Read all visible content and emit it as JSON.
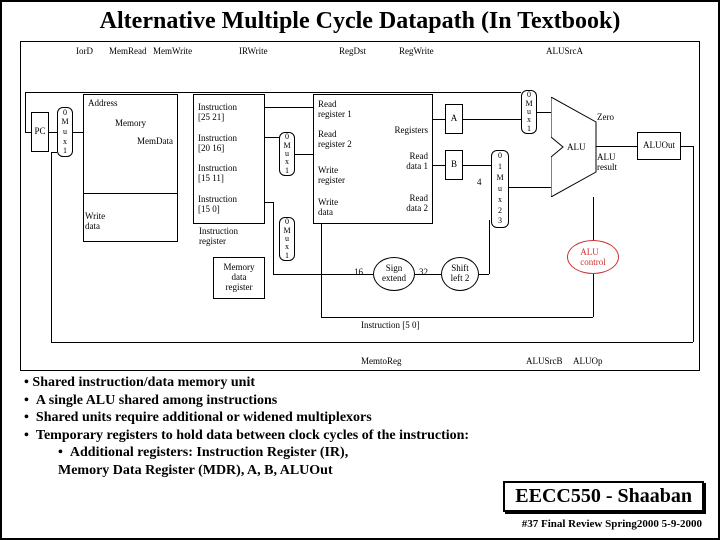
{
  "title": "Alternative Multiple Cycle Datapath (In Textbook)",
  "signals_top": {
    "iord": "IorD",
    "memread": "MemRead",
    "memwrite": "MemWrite",
    "irwrite": "IRWrite",
    "regdst": "RegDst",
    "regwrite": "RegWrite",
    "alusrca": "ALUSrcA"
  },
  "signals_bottom": {
    "memtoreg": "MemtoReg",
    "alusrcb": "ALUSrcB",
    "aluop": "ALUOp"
  },
  "blocks": {
    "pc": "PC",
    "mux01a": [
      "0",
      "M",
      "u",
      "x",
      "1"
    ],
    "address": "Address",
    "memory": "Memory",
    "memdata": "MemData",
    "writedata": "Write\ndata",
    "ir_lines": [
      "Instruction",
      "[25  21]",
      "Instruction",
      "[20  16]",
      "Instruction",
      "[15  11]",
      "Instruction",
      "[15   0]"
    ],
    "ir_caption": "Instruction\nregister",
    "mdr": "Memory\ndata\nregister",
    "mux01b": [
      "0",
      "M",
      "u",
      "x",
      "1"
    ],
    "mux01c": [
      "0",
      "M",
      "u",
      "x",
      "1"
    ],
    "regfile": {
      "rr1": "Read\nregister 1",
      "rr2": "Read\nregister 2",
      "regs": "Registers",
      "wr": "Write\nregister",
      "wd": "Write\ndata",
      "rd1": "Read\ndata 1",
      "rd2": "Read\ndata 2"
    },
    "a": "A",
    "b": "B",
    "four": "4",
    "mux4": [
      "0",
      "1",
      "M",
      "u",
      "x",
      "2",
      "3"
    ],
    "mux01d": [
      "0",
      "M",
      "u",
      "x",
      "1"
    ],
    "signext": "Sign\nextend",
    "se16": "16",
    "se32": "32",
    "shl2": "Shift\nleft 2",
    "zero": "Zero",
    "alu": "ALU",
    "alures": "ALU\nresult",
    "aluout": "ALUOut",
    "aluctrl": "ALU\ncontrol",
    "instr50": "Instruction [5   0]"
  },
  "bullets": {
    "b1": "Shared instruction/data memory unit",
    "b2": "A single ALU shared among instructions",
    "b3": "Shared units require additional or widened multiplexors",
    "b4": "Temporary registers to hold data between clock cycles of the instruction:",
    "b4a": "Additional registers:  Instruction Register (IR),",
    "b4b": "Memory Data Register (MDR),  A, B,  ALUOut"
  },
  "footer": {
    "course": "EECC550 - Shaaban",
    "line": "#37   Final Review    Spring2000    5-9-2000"
  }
}
